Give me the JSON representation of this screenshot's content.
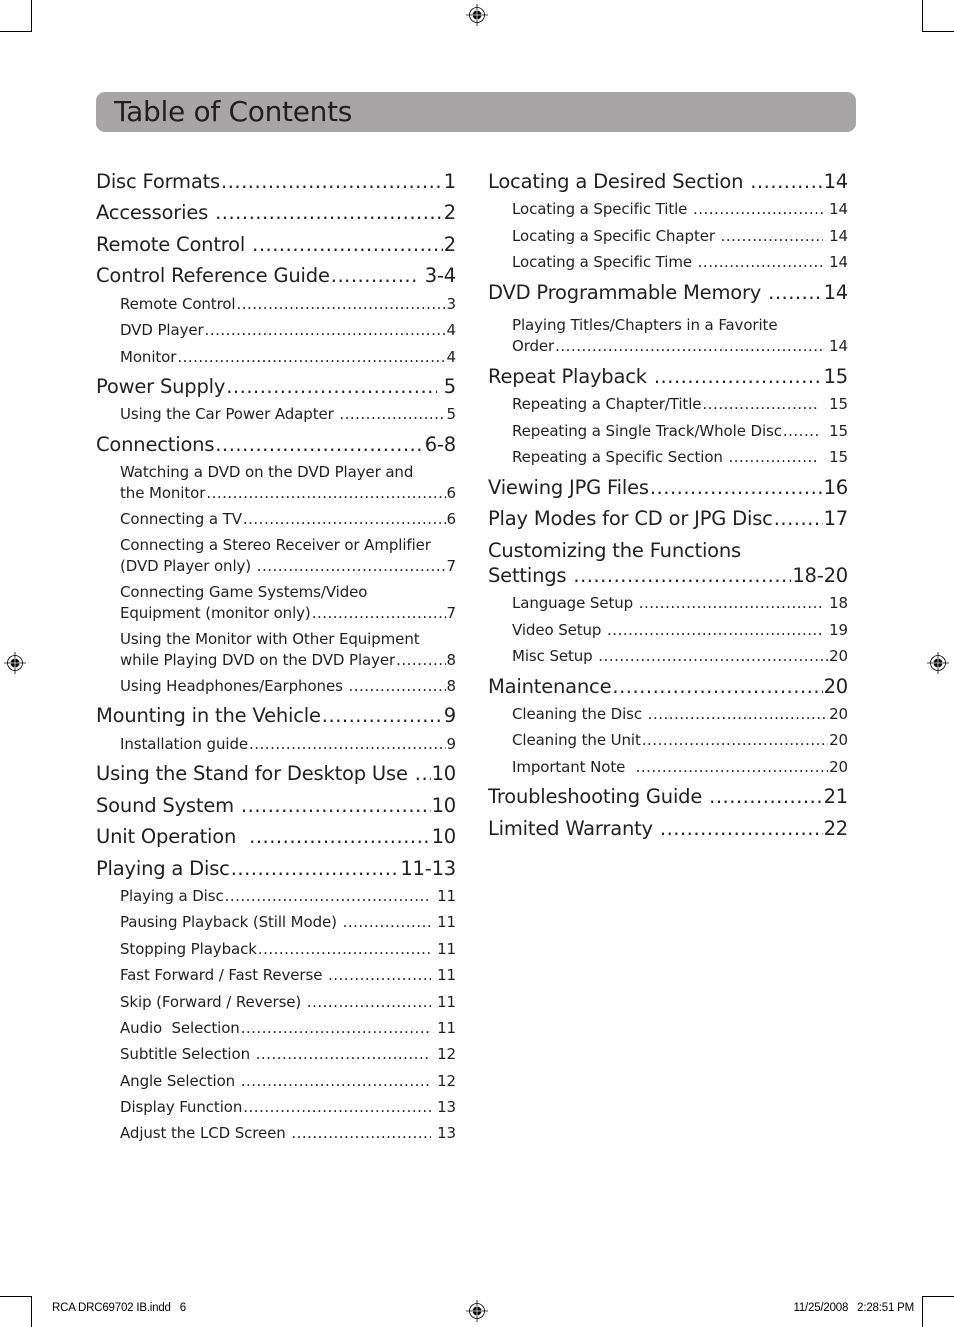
{
  "page": {
    "title": "Table of Contents",
    "accent_bar_color": "#a7a5a6",
    "text_color": "#231f20"
  },
  "left_column": {
    "entries": [
      {
        "level": "main",
        "label": "Disc Formats",
        "page": "1"
      },
      {
        "level": "main",
        "label": "Accessories ",
        "page": "2"
      },
      {
        "level": "main",
        "label": "Remote Control ",
        "page": "2"
      },
      {
        "level": "main",
        "label": "Control Reference Guide",
        "page": " 3-4"
      },
      {
        "level": "sub",
        "label": "Remote Control",
        "page": "3"
      },
      {
        "level": "sub",
        "label": "DVD Player",
        "page": "4"
      },
      {
        "level": "sub",
        "label": "Monitor",
        "page": "4"
      },
      {
        "level": "main",
        "label": "Power Supply",
        "page": " 5"
      },
      {
        "level": "sub",
        "label": "Using the Car Power Adapter ",
        "page": "5"
      },
      {
        "level": "main",
        "label": "Connections",
        "page": "6-8"
      },
      {
        "level": "sub",
        "label_line1": "Watching a DVD on the DVD Player and",
        "label": "the Monitor",
        "page": "6"
      },
      {
        "level": "sub",
        "label": "Connecting a TV",
        "page": "6"
      },
      {
        "level": "sub",
        "label_line1": "Connecting a Stereo Receiver or Amplifier",
        "label": "(DVD Player only) ",
        "page": "7"
      },
      {
        "level": "sub",
        "label_line1": "Connecting Game Systems/Video",
        "label": "Equipment (monitor only)",
        "page": "7"
      },
      {
        "level": "sub",
        "label_line1": "Using the Monitor with Other Equipment",
        "label": "while Playing DVD on the DVD Player",
        "page": "8"
      },
      {
        "level": "sub",
        "label": "Using Headphones/Earphones ",
        "page": "8"
      },
      {
        "level": "main",
        "label": "Mounting in the Vehicle",
        "page": "9"
      },
      {
        "level": "sub",
        "label": "Installation guide",
        "page": "9"
      },
      {
        "level": "main",
        "label": "Using the Stand for Desktop Use ",
        "page": "10"
      },
      {
        "level": "main",
        "label": "Sound System ",
        "page": "10"
      },
      {
        "level": "main",
        "label": "Unit Operation  ",
        "page": "10"
      },
      {
        "level": "main",
        "label": "Playing a Disc",
        "page": "11-13"
      },
      {
        "level": "sub",
        "label": "Playing a Disc",
        "page": " 11"
      },
      {
        "level": "sub",
        "label": "Pausing Playback (Still Mode) ",
        "page": " 11"
      },
      {
        "level": "sub",
        "label": "Stopping Playback",
        "page": " 11"
      },
      {
        "level": "sub",
        "label": "Fast Forward / Fast Reverse ",
        "page": " 11"
      },
      {
        "level": "sub",
        "label": "Skip (Forward / Reverse) ",
        "page": " 11"
      },
      {
        "level": "sub",
        "label": "Audio  Selection",
        "page": " 11"
      },
      {
        "level": "sub",
        "label": "Subtitle Selection ",
        "page": " 12"
      },
      {
        "level": "sub",
        "label": "Angle Selection ",
        "page": " 12"
      },
      {
        "level": "sub",
        "label": "Display Function",
        "page": " 13"
      },
      {
        "level": "sub",
        "label": "Adjust the LCD Screen ",
        "page": " 13"
      }
    ]
  },
  "right_column": {
    "entries": [
      {
        "level": "main",
        "label": "Locating a Desired Section ",
        "page": "14"
      },
      {
        "level": "sub",
        "label": "Locating a Specific Title ",
        "page": " 14"
      },
      {
        "level": "sub",
        "label": "Locating a Specific Chapter ",
        "page": " 14"
      },
      {
        "level": "sub",
        "label": "Locating a Specific Time ",
        "page": " 14"
      },
      {
        "level": "main",
        "label": "DVD Programmable Memory ",
        "page": "14"
      },
      {
        "level": "sub",
        "label_line1": "Playing Titles/Chapters in a Favorite",
        "label": "Order",
        "page": " 14"
      },
      {
        "level": "main",
        "label": "Repeat Playback ",
        "page": "15"
      },
      {
        "level": "sub",
        "label": "Repeating a Chapter/Title",
        "page": "  15"
      },
      {
        "level": "sub",
        "label": "Repeating a Single Track/Whole Disc",
        "page": "  15"
      },
      {
        "level": "sub",
        "label": "Repeating a Specific Section ",
        "page": "  15"
      },
      {
        "level": "main",
        "label": "Viewing JPG Files",
        "page": "16"
      },
      {
        "level": "main",
        "label": "Play Modes for CD or JPG Disc",
        "page": "17"
      },
      {
        "level": "main",
        "label_line1": "Customizing the Functions",
        "label": "Settings ",
        "page": "18-20"
      },
      {
        "level": "sub",
        "label": "Language Setup ",
        "page": " 18"
      },
      {
        "level": "sub",
        "label": "Video Setup ",
        "page": " 19"
      },
      {
        "level": "sub",
        "label": "Misc Setup ",
        "page": "20"
      },
      {
        "level": "main",
        "label": "Maintenance",
        "page": "20"
      },
      {
        "level": "sub",
        "label": "Cleaning the Disc ",
        "page": "20"
      },
      {
        "level": "sub",
        "label": "Cleaning the Unit",
        "page": "20"
      },
      {
        "level": "sub",
        "label": "Important Note  ",
        "page": "20"
      },
      {
        "level": "main",
        "label": "Troubleshooting Guide ",
        "page": "21"
      },
      {
        "level": "main",
        "label": "Limited Warranty ",
        "page": "22"
      }
    ]
  },
  "footer": {
    "file_slug": "RCA DRC69702 IB.indd   6",
    "timestamp": "11/25/2008   2:28:51 PM"
  },
  "print_marks": {
    "registration_icon": "registration-target-icon",
    "crop_icon": "crop-mark-icon"
  }
}
